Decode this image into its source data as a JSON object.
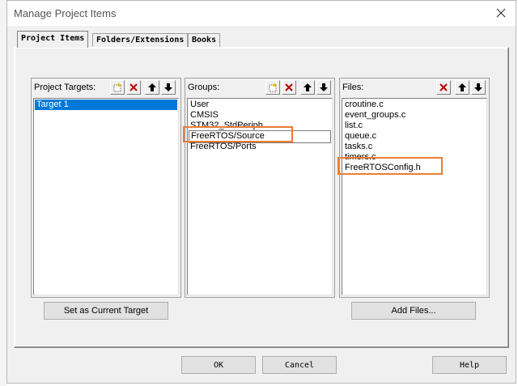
{
  "window": {
    "title": "Manage Project Items"
  },
  "tabs": [
    {
      "label": "Project Items"
    },
    {
      "label": "Folders/Extensions"
    },
    {
      "label": "Books"
    }
  ],
  "targets": {
    "label": "Project Targets:",
    "items": [
      "Target 1"
    ]
  },
  "groups": {
    "label": "Groups:",
    "items": [
      "User",
      "CMSIS",
      "STM32_StdPeriph",
      "FreeRTOS/Source",
      "FreeRTOS/Ports"
    ]
  },
  "files": {
    "label": "Files:",
    "items": [
      "croutine.c",
      "event_groups.c",
      "list.c",
      "queue.c",
      "tasks.c",
      "timers.c",
      "FreeRTOSConfig.h"
    ]
  },
  "buttons": {
    "set_current": "Set as Current Target",
    "add_files": "Add Files...",
    "ok": "OK",
    "cancel": "Cancel",
    "help": "Help"
  },
  "colors": {
    "selection": "#0078d7",
    "highlight_box": "#ed7d31",
    "delete_icon": "#c00000"
  }
}
